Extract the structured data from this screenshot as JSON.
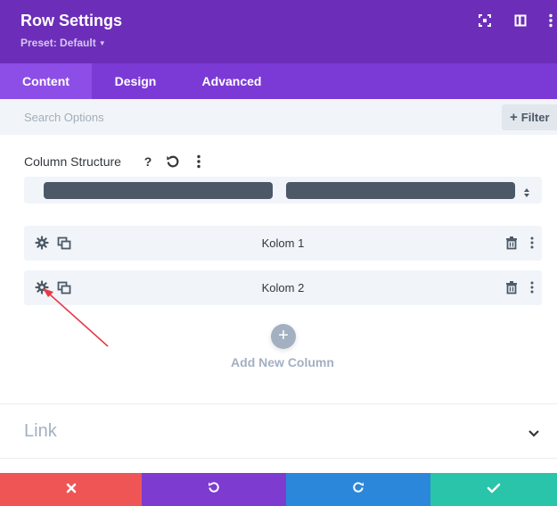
{
  "header": {
    "title": "Row Settings",
    "preset": "Preset: Default",
    "bg_color": "#6c2eb9",
    "icons": [
      "expand-icon",
      "split-view-icon",
      "more-options-icon"
    ]
  },
  "tabs": [
    {
      "label": "Content",
      "active": true
    },
    {
      "label": "Design",
      "active": false
    },
    {
      "label": "Advanced",
      "active": false
    }
  ],
  "search": {
    "placeholder": "Search Options",
    "filter_label": "Filter"
  },
  "column_structure": {
    "label": "Column Structure",
    "help_label": "?",
    "selected_columns": 2
  },
  "columns": [
    {
      "label": "Kolom 1"
    },
    {
      "label": "Kolom 2"
    }
  ],
  "add_column": {
    "label": "Add New Column"
  },
  "link_section": {
    "label": "Link"
  },
  "footer": {
    "colors": {
      "cancel": "#ef5555",
      "undo": "#7e3bd0",
      "redo": "#2b87da",
      "save": "#29c4a9"
    }
  },
  "annotation": {
    "color": "#e8394a"
  }
}
